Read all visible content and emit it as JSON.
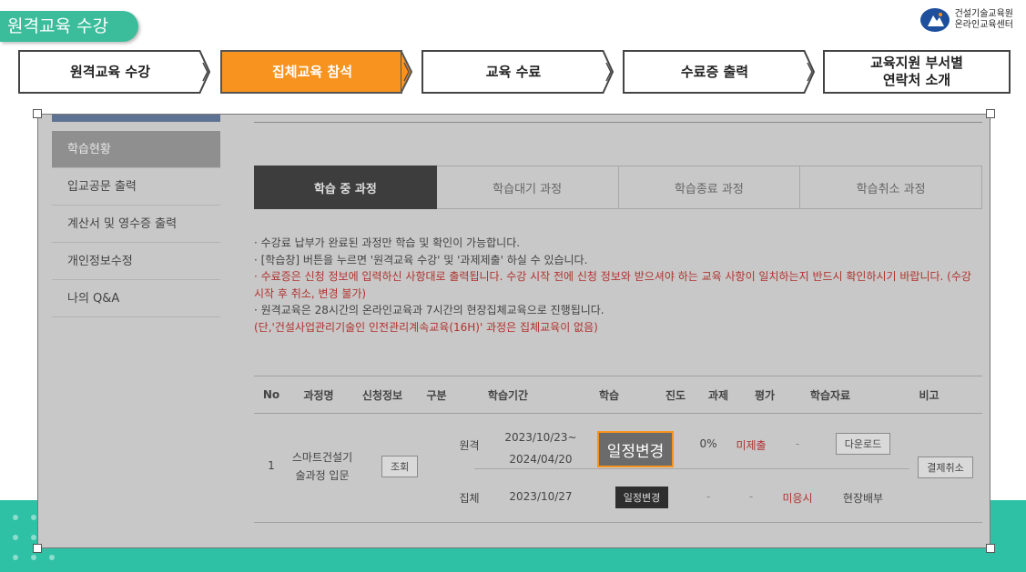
{
  "header": {
    "title": "원격교육 수강",
    "logo_line1": "건설기술교육원",
    "logo_line2": "온라인교육센터"
  },
  "steps": [
    {
      "label": "원격교육 수강",
      "active": false
    },
    {
      "label": "집체교육 참석",
      "active": true
    },
    {
      "label": "교육 수료",
      "active": false
    },
    {
      "label": "수료증 출력",
      "active": false
    },
    {
      "label": "교육지원 부서별\n연락처 소개",
      "active": false
    }
  ],
  "sidebar": {
    "items": [
      {
        "label": "학습현황"
      },
      {
        "label": "입교공문 출력"
      },
      {
        "label": "계산서 및 영수증 출력"
      },
      {
        "label": "개인정보수정"
      },
      {
        "label": "나의 Q&A"
      }
    ]
  },
  "tabs": [
    {
      "label": "학습 중 과정"
    },
    {
      "label": "학습대기 과정"
    },
    {
      "label": "학습종료 과정"
    },
    {
      "label": "학습취소 과정"
    }
  ],
  "notes": {
    "line1": "· 수강료 납부가 완료된 과정만 학습 및 확인이 가능합니다.",
    "line2": "· [학습창] 버튼을 누르면 '원격교육 수강' 및 '과제제출' 하실 수 있습니다.",
    "line3": "· 수료증은 신청 정보에 입력하신 사항대로 출력됩니다. 수강 시작 전에 신청 정보와 받으셔야 하는 교육 사항이 일치하는지 반드시 확인하시기 바랍니다. (수강 시작 후 취소, 변경 불가)",
    "line4": "· 원격교육은 28시간의 온라인교육과 7시간의 현장집체교육으로 진행됩니다.",
    "line5": "(단,'건설사업관리기술인 인전관리계속교육(16H)' 과정은 집체교육이 없음)"
  },
  "table": {
    "headers": {
      "no": "No",
      "name": "과정명",
      "info": "신청정보",
      "type": "구분",
      "period": "학습기간",
      "study": "학습",
      "progress": "진도",
      "task": "과제",
      "eval": "평가",
      "material": "학습자료",
      "note": "비고"
    },
    "row": {
      "no": "1",
      "name": "스마트건설기술과정 입문",
      "info_button": "조회",
      "online": {
        "type": "원격",
        "period_start": "2023/10/23~",
        "period_end": "2024/04/20",
        "study_button": "일정변경",
        "progress": "0%",
        "task": "미제출",
        "eval": "-",
        "material_button": "다운로드"
      },
      "offline": {
        "type": "집체",
        "period": "2023/10/27",
        "study_button": "일정변경",
        "progress": "-",
        "task": "-",
        "eval": "미응시",
        "material": "현장배부"
      },
      "note_button": "결제취소"
    }
  },
  "colors": {
    "accent_orange": "#f7931e",
    "teal": "#2ec1a6",
    "red_text": "#b0332f"
  }
}
